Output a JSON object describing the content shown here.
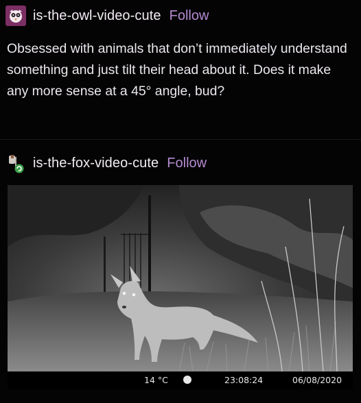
{
  "posts": [
    {
      "username": "is-the-owl-video-cute",
      "follow_label": "Follow",
      "text": "Obsessed with animals that don’t immediately understand something and just tilt their head about it. Does it make any more sense at a 45° angle, bud?",
      "avatar_icon": "owl-avatar-icon"
    },
    {
      "username": "is-the-fox-video-cute",
      "follow_label": "Follow",
      "avatar_icon": "fox-avatar-icon",
      "video": {
        "temperature": "14 °C",
        "time": "23:08:24",
        "date": "06/08/2020",
        "moon_icon": "moon-phase-icon"
      }
    }
  ],
  "colors": {
    "background": "#050405",
    "follow": "#b58bd1",
    "owl_avatar_bg": "#7b2f62"
  }
}
